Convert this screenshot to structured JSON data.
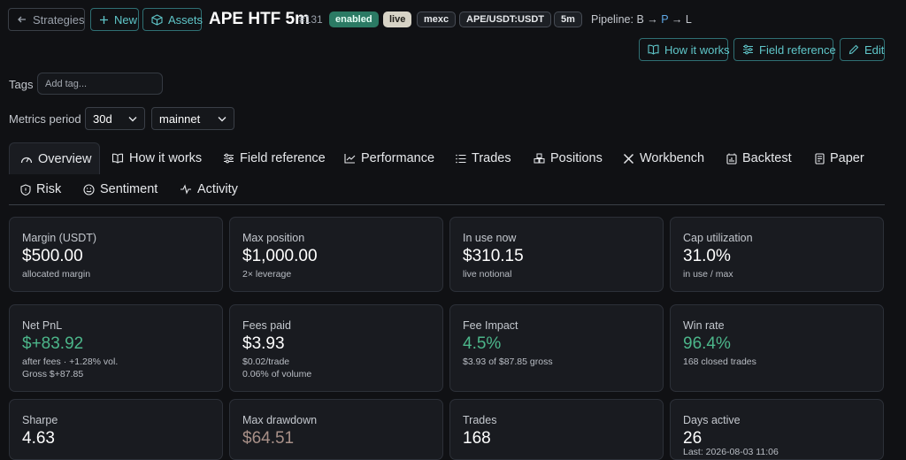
{
  "header": {
    "back_label": "Strategies",
    "new_label": "New",
    "assets_label": "Assets",
    "title": "APE HTF 5m",
    "strategy_id": "#131",
    "badges": {
      "enabled": "enabled",
      "live": "live",
      "exchange": "mexc",
      "pair": "APE/USDT:USDT",
      "timeframe": "5m"
    },
    "pipeline_label": "Pipeline:",
    "pipeline_b": "B",
    "pipeline_p": "P",
    "pipeline_l": "L",
    "actions": {
      "how_it_works": "How it works",
      "field_reference": "Field reference",
      "edit": "Edit"
    }
  },
  "tags": {
    "label": "Tags",
    "placeholder": "Add tag..."
  },
  "metrics_period": {
    "label": "Metrics period",
    "period_value": "30d",
    "network_value": "mainnet"
  },
  "tabs": [
    {
      "label": "Overview",
      "icon": "gauge-icon"
    },
    {
      "label": "How it works",
      "icon": "book-icon"
    },
    {
      "label": "Field reference",
      "icon": "sliders-icon"
    },
    {
      "label": "Performance",
      "icon": "line-chart-icon"
    },
    {
      "label": "Trades",
      "icon": "list-icon"
    },
    {
      "label": "Positions",
      "icon": "boxes-icon"
    },
    {
      "label": "Workbench",
      "icon": "tools-icon"
    },
    {
      "label": "Backtest",
      "icon": "calendar-chart-icon"
    },
    {
      "label": "Paper",
      "icon": "document-icon"
    },
    {
      "label": "Risk",
      "icon": "shield-icon"
    },
    {
      "label": "Sentiment",
      "icon": "smile-icon"
    },
    {
      "label": "Activity",
      "icon": "activity-icon"
    }
  ],
  "cards": [
    {
      "label": "Margin (USDT)",
      "value": "$500.00",
      "sub1": "allocated margin"
    },
    {
      "label": "Max position",
      "value": "$1,000.00",
      "sub1": "2× leverage"
    },
    {
      "label": "In use now",
      "value": "$310.15",
      "sub1": "live notional"
    },
    {
      "label": "Cap utilization",
      "value": "31.0%",
      "sub1": "in use / max"
    },
    {
      "label": "Net PnL",
      "value": "$+83.92",
      "sub1": "after fees · +1.28% vol.",
      "sub2": "Gross $+87.85"
    },
    {
      "label": "Fees paid",
      "value": "$3.93",
      "sub1": "$0.02/trade",
      "sub2": "0.06% of volume"
    },
    {
      "label": "Fee Impact",
      "value": "4.5%",
      "sub1": "$3.93 of $87.85 gross"
    },
    {
      "label": "Win rate",
      "value": "96.4%",
      "sub1": "168 closed trades"
    },
    {
      "label": "Sharpe",
      "value": "4.63"
    },
    {
      "label": "Max drawdown",
      "value": "$64.51"
    },
    {
      "label": "Trades",
      "value": "168"
    },
    {
      "label": "Days active",
      "value": "26",
      "sub1": "Last: 2026-08-03 11:06"
    }
  ],
  "colors": {
    "accent_teal": "#5fc6c9",
    "positive": "#4cb68a",
    "enabled_badge": "#2b7a64",
    "background": "#101114"
  }
}
